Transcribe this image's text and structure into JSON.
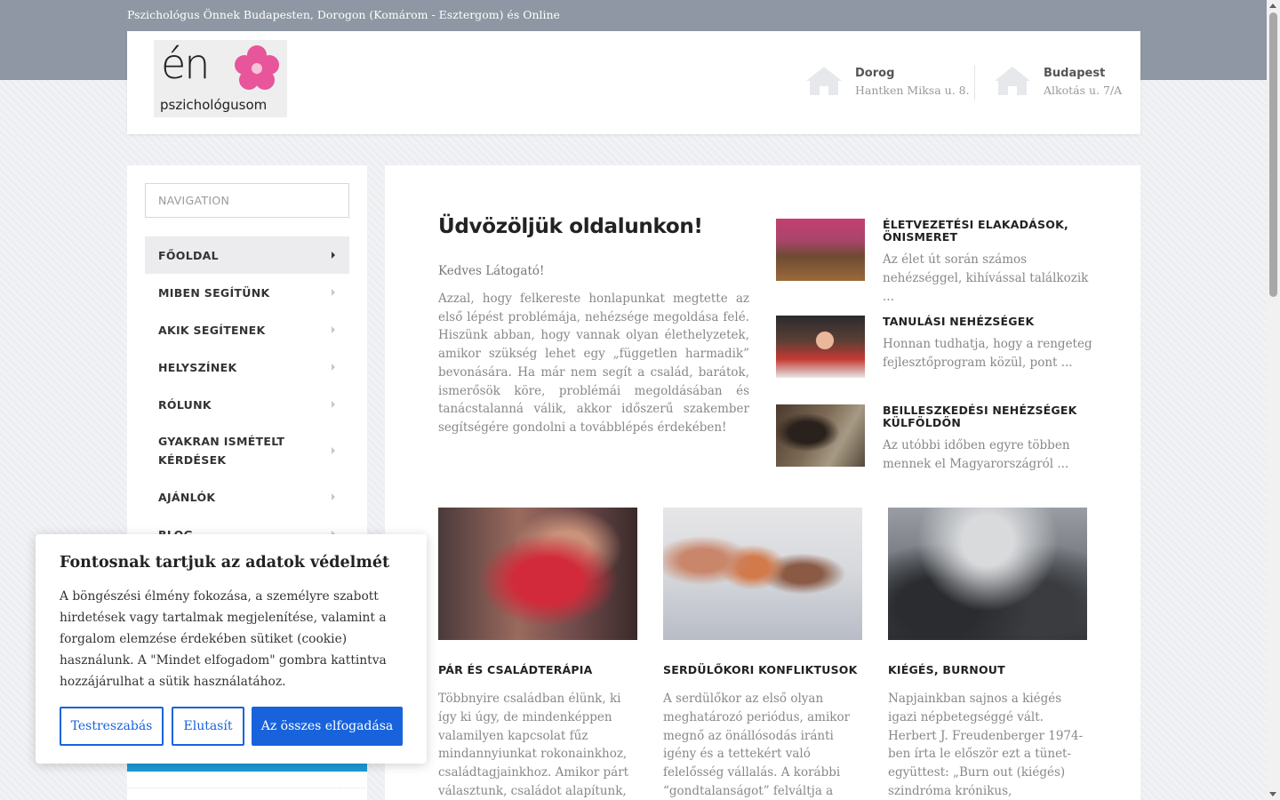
{
  "topbar": {
    "tagline": "Pszichológus Önnek Budapesten, Dorogon (Komárom - Esztergom) és Online"
  },
  "header": {
    "logo": {
      "big": "én",
      "small": "pszichológusom"
    },
    "locations": [
      {
        "name": "Dorog",
        "address": "Hantken Miksa u. 8.",
        "icon": "house-icon"
      },
      {
        "name": "Budapest",
        "address": "Alkotás u. 7/A",
        "icon": "house-icon"
      }
    ]
  },
  "sidebar": {
    "nav_placeholder": "NAVIGATION",
    "items": [
      {
        "label": "FŐOLDAL",
        "active": true
      },
      {
        "label": "MIBEN SEGÍTÜNK"
      },
      {
        "label": "AKIK SEGÍTENEK"
      },
      {
        "label": "HELYSZÍNEK"
      },
      {
        "label": "RÓLUNK"
      },
      {
        "label": "GYAKRAN ISMÉTELT KÉRDÉSEK"
      },
      {
        "label": "AJÁNLÓK"
      },
      {
        "label": "BLOG"
      }
    ]
  },
  "main": {
    "title": "Üdvözöljük oldalunkon!",
    "greeting": "Kedves Látogató!",
    "intro": "Azzal, hogy felkereste honlapunkat megtette az első lépést problémája, nehézsége megoldása felé. Hiszünk abban, hogy vannak olyan élethelyzetek, amikor szükség lehet egy „független harmadik” bevonására. Ha már nem segít a család, barátok, ismerősök köre, problémái megoldásában és tanácstalanná válik, akkor időszerű szakember segítségére gondolni a továbblépés érdekében!",
    "side_posts": [
      {
        "title": "ÉLETVEZETÉSI ELAKADÁSOK, ÖNISMERET",
        "excerpt": "Az élet út során számos nehézséggel, kihívással találkozik ..."
      },
      {
        "title": "TANULÁSI NEHÉZSÉGEK",
        "excerpt": "Honnan tudhatja, hogy a rengeteg fejlesztőprogram közül, pont ..."
      },
      {
        "title": "BEILLESZKEDÉSI NEHÉZSÉGEK KÜLFÖLDÖN",
        "excerpt": "Az utóbbi időben egyre többen mennek el Magyarországról ..."
      }
    ],
    "cards": [
      {
        "title": "PÁR ÉS CSALÁDTERÁPIA",
        "text": "Többnyire családban élünk, ki így ki úgy, de mindenképpen valamilyen kapcsolat fűz mindannyiunkat rokonainkhoz, családtagjainkhoz. Amikor párt választunk, családot alapítunk,"
      },
      {
        "title": "SERDÜLŐKORI KONFLIKTUSOK",
        "text": "A serdülőkor az első olyan meghatározó periódus, amikor megnő az önállósodás iránti igény és a tettekért való felelősség vállalás. A korábbi “gondtalanságot” felváltja a felnőtt"
      },
      {
        "title": "KIÉGÉS, BURNOUT",
        "text": "Napjainkban sajnos a kiégés igazi népbetegséggé vált. Herbert J. Freudenberger 1974-ben írta le először ezt a tünet-együttest: „Burn out (kiégés) szindróma krónikus, emocionális megterhelések,"
      }
    ]
  },
  "cookie": {
    "title": "Fontosnak tartjuk az adatok védelmét",
    "body": "A böngészési élmény fokozása, a személyre szabott hirdetések vagy tartalmak megjelenítése, valamint a forgalom elemzése érdekében sütiket (cookie) használunk. A \"Mindet elfogadom\" gombra kattintva hozzájárulhat a sütik használatához.",
    "customize": "Testreszabás",
    "reject": "Elutasít",
    "accept": "Az összes elfogadása",
    "accent": "#1863dc"
  }
}
